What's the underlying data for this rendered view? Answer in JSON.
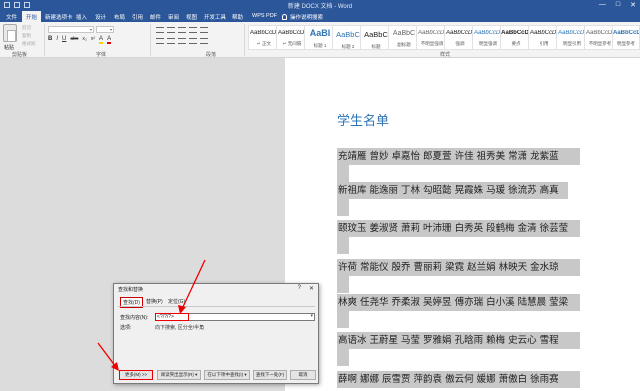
{
  "window": {
    "title": "新建 DOCX 文档 - Word",
    "controls": [
      "—",
      "□",
      "✕"
    ]
  },
  "tabs": [
    {
      "label": "文件"
    },
    {
      "label": "开始"
    },
    {
      "label": "新建选项卡"
    },
    {
      "label": "插入"
    },
    {
      "label": "设计"
    },
    {
      "label": "布局"
    },
    {
      "label": "引用"
    },
    {
      "label": "邮件"
    },
    {
      "label": "审阅"
    },
    {
      "label": "视图"
    },
    {
      "label": "开发工具"
    },
    {
      "label": "帮助"
    },
    {
      "label": "WPS PDF"
    },
    {
      "label": "操作说明搜索"
    }
  ],
  "ribbon": {
    "paste_label": "粘贴",
    "clipboard_minis": [
      "剪切",
      "复制",
      "格式刷"
    ],
    "groups": {
      "clipboard": "剪贴板",
      "font": "字体",
      "paragraph": "段落",
      "styles": "样式"
    },
    "font_buttons": [
      "B",
      "I",
      "U",
      "abc",
      "x₂",
      "x²",
      "A",
      "A"
    ],
    "styles": [
      {
        "sample": "AaBbCcDt",
        "name": "↵ 正文"
      },
      {
        "sample": "AaBbCcDt",
        "name": "↵ 无间隔"
      },
      {
        "sample": "AaBI",
        "name": "标题 1"
      },
      {
        "sample": "AaBbC",
        "name": "标题 2"
      },
      {
        "sample": "AaBbC",
        "name": "标题"
      },
      {
        "sample": "AaBbC",
        "name": "副标题"
      },
      {
        "sample": "AaBbCcDt",
        "name": "不明显强调"
      },
      {
        "sample": "AaBbCcDt",
        "name": "强调"
      },
      {
        "sample": "AaBbCcDt",
        "name": "明显强调"
      },
      {
        "sample": "AaBbCcDt",
        "name": "要点"
      },
      {
        "sample": "AaBbCcDt",
        "name": "引用"
      },
      {
        "sample": "AaBbCcDt",
        "name": "明显引用"
      },
      {
        "sample": "AaBbCcDt",
        "name": "不明显参考"
      },
      {
        "sample": "AaBbCcDt",
        "name": "明显参考"
      }
    ]
  },
  "document": {
    "title": "学生名单",
    "lines": [
      "充靖雁  曾妙  卓嘉怡  郎夏萱  许佳  祖秀美  常潇  龙紫蓝",
      "新祖库  能逸丽  丁林  勾昭懿  晃霞姝  马瑗  徐流苏  高真",
      "颐玟玉  姜淑贤  萧莉  叶沛珊  白秀英  段鹤梅  金清  徐芸莹",
      "许荷  常能仪  殷乔  曹丽莉  梁霓  赵兰娟  林映天  金水琼",
      "林爽  任尧华  乔柔淑  吴婷昱  傅亦瑞  白小溪  陆慧晨  莹梁",
      "高语冰  王蔚星  马莹  罗雅娟  孔晗雨  赖梅  史云心  雪程",
      "薛啊  娜娜  辰雪贾  萍韵袁  傲云何  媛娜  萧傲白  徐雨赛"
    ]
  },
  "dialog": {
    "title": "查找和替换",
    "controls": [
      "?",
      "✕"
    ],
    "tabs": [
      "查找(D)",
      "替换(P)",
      "定位(G)"
    ],
    "find_label": "查找内容(N):",
    "find_value": "<?/?/?>",
    "options_label": "选项:",
    "options_value": "向下搜索, 区分全/半角",
    "buttons": {
      "more": "更多(M) >>",
      "reading_highlight": "阅读突出显示(R) ▾",
      "find_in": "在以下项中查找(I) ▾",
      "find_next": "查找下一处(F)",
      "cancel": "取消"
    }
  }
}
